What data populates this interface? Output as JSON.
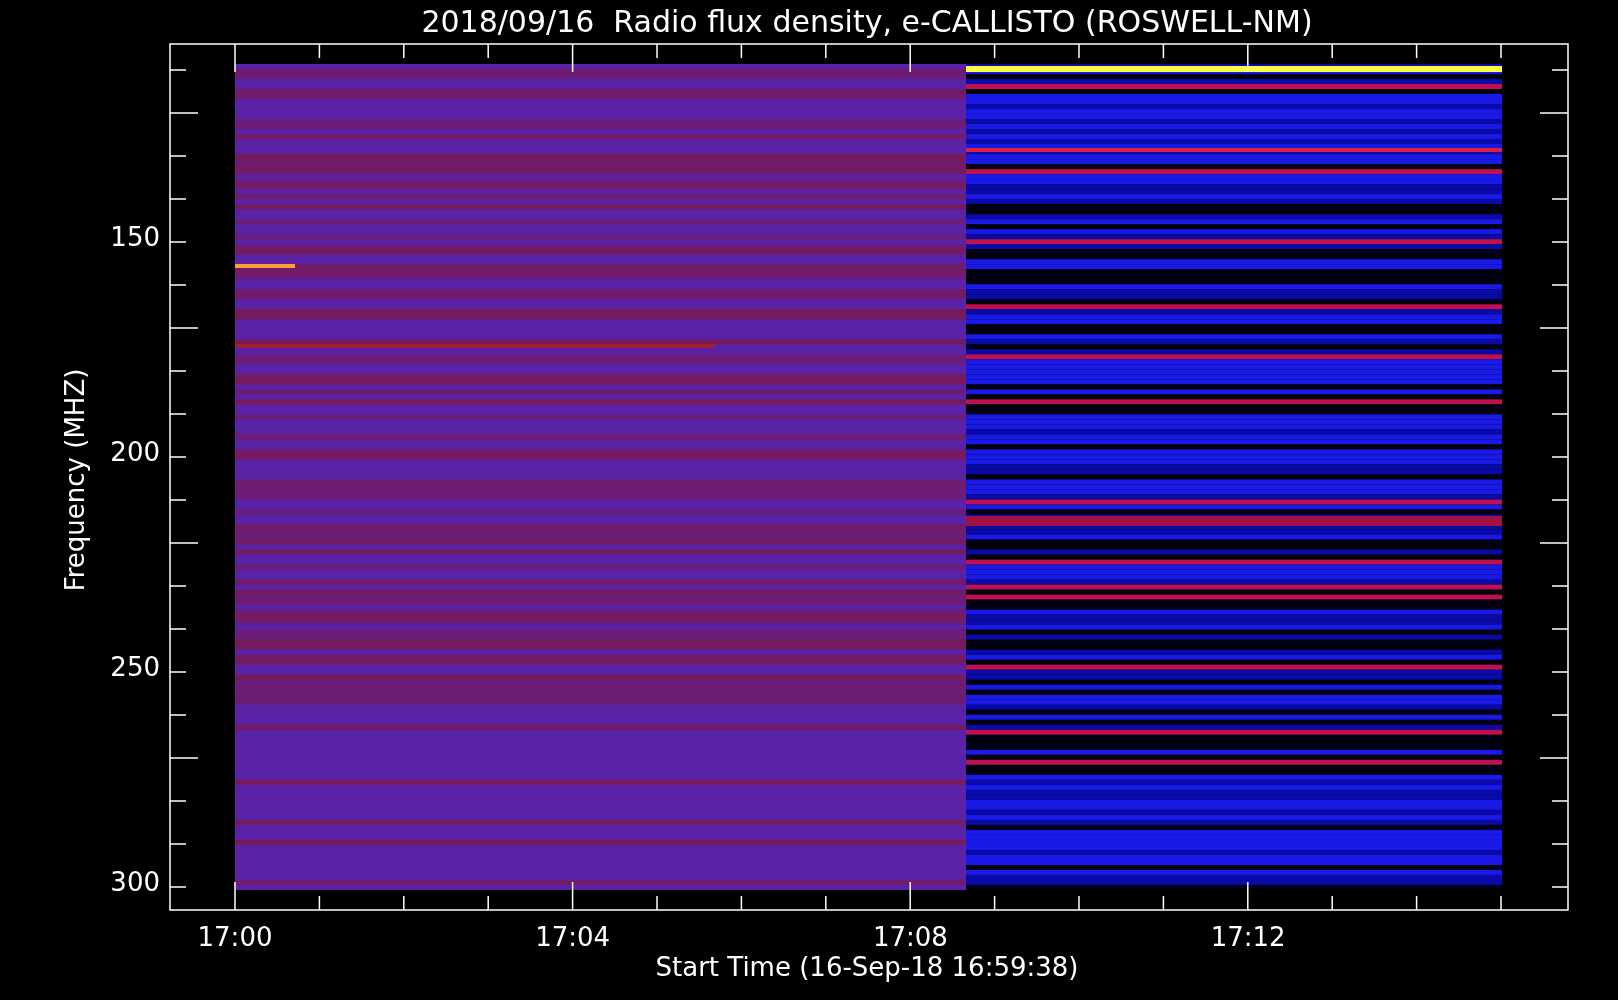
{
  "title": "2018/09/16  Radio flux density, e-CALLISTO (ROSWELL-NM)",
  "plot": {
    "ylabel": "Frequency (MHZ)",
    "yticks": [
      "150",
      "200",
      "250",
      "300"
    ],
    "xticks": [
      "17:00",
      "17:04",
      "17:08",
      "17:12"
    ],
    "xlabel": "Start Time (16-Sep-18 16:59:38)"
  }
}
